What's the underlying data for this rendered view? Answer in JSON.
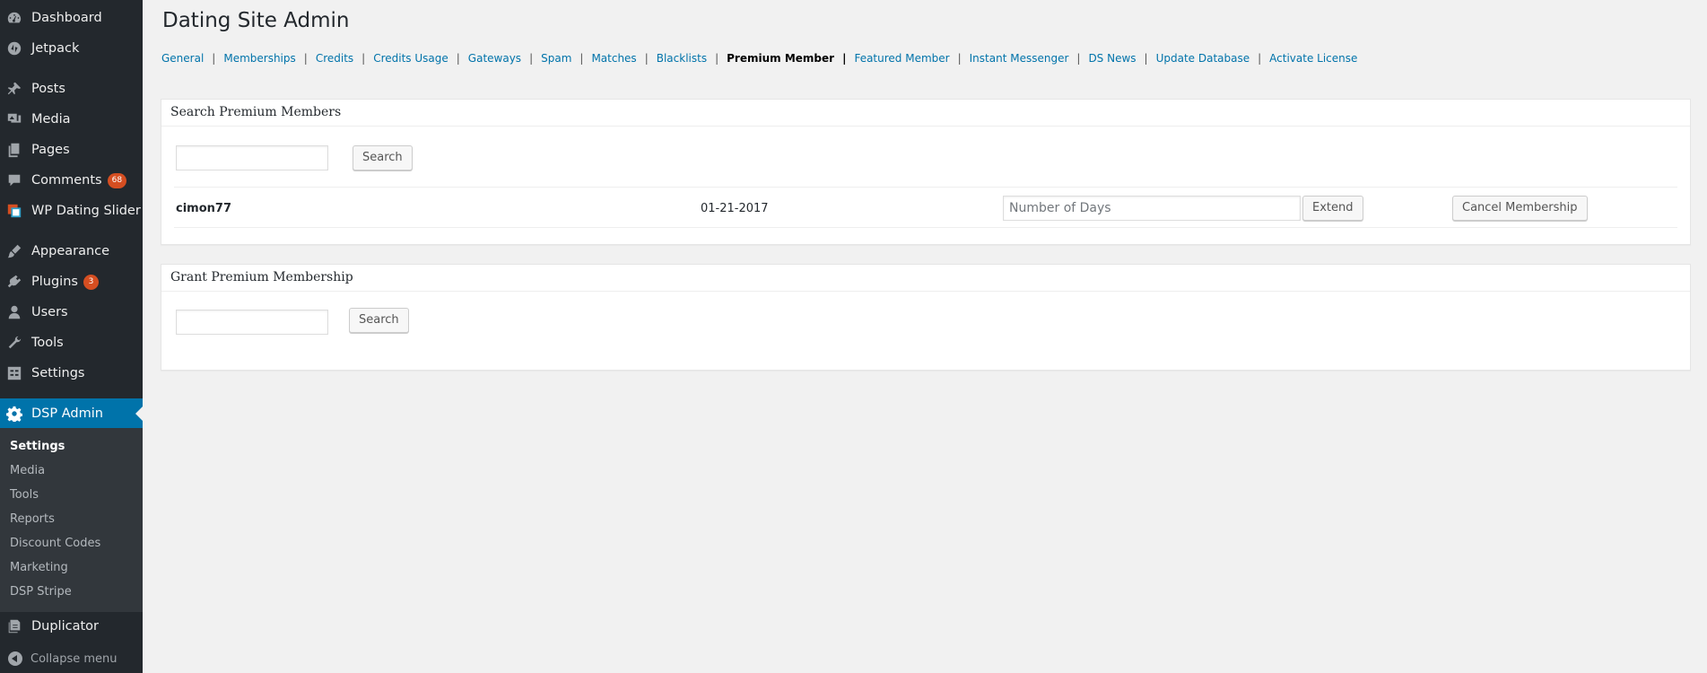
{
  "sidebar": {
    "items": [
      {
        "label": "Dashboard",
        "icon": "dashboard-icon"
      },
      {
        "label": "Jetpack",
        "icon": "jetpack-icon"
      },
      {
        "label": "Posts",
        "icon": "pin-icon"
      },
      {
        "label": "Media",
        "icon": "media-icon"
      },
      {
        "label": "Pages",
        "icon": "pages-icon"
      },
      {
        "label": "Comments",
        "icon": "comment-icon",
        "badge": "68"
      },
      {
        "label": "WP Dating Slider",
        "icon": "slider-icon"
      },
      {
        "label": "Appearance",
        "icon": "brush-icon"
      },
      {
        "label": "Plugins",
        "icon": "plugin-icon",
        "badge": "3"
      },
      {
        "label": "Users",
        "icon": "user-icon"
      },
      {
        "label": "Tools",
        "icon": "wrench-icon"
      },
      {
        "label": "Settings",
        "icon": "settings-icon"
      },
      {
        "label": "DSP Admin",
        "icon": "gear-icon"
      },
      {
        "label": "Duplicator",
        "icon": "duplicator-icon"
      }
    ],
    "submenu": [
      "Settings",
      "Media",
      "Tools",
      "Reports",
      "Discount Codes",
      "Marketing",
      "DSP Stripe"
    ],
    "collapse_label": "Collapse menu"
  },
  "page": {
    "title": "Dating Site Admin"
  },
  "tabs": [
    "General",
    "Memberships",
    "Credits",
    "Credits Usage",
    "Gateways",
    "Spam",
    "Matches",
    "Blacklists",
    "Premium Member",
    "Featured Member",
    "Instant Messenger",
    "DS News",
    "Update Database",
    "Activate License"
  ],
  "tab_separator": "|",
  "search_box": {
    "title": "Search Premium Members",
    "search_value": "",
    "search_button": "Search",
    "member": {
      "username": "cimon77",
      "date": "01-21-2017",
      "days_placeholder": "Number of Days",
      "extend_button": "Extend",
      "cancel_button": "Cancel Membership"
    }
  },
  "grant_box": {
    "title": "Grant Premium Membership",
    "search_value": "",
    "search_button": "Search"
  },
  "colors": {
    "sidebar_bg": "#23282d",
    "submenu_bg": "#32373c",
    "active_bg": "#0073aa",
    "link": "#0073aa",
    "badge": "#d54e21",
    "page_bg": "#f1f1f1"
  }
}
